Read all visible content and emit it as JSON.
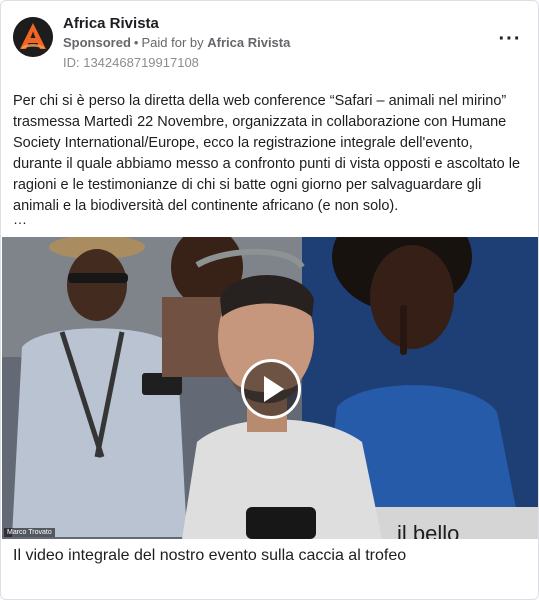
{
  "post": {
    "page_name": "Africa Rivista",
    "sponsored_label": "Sponsored",
    "separator": "•",
    "paid_for_label": "Paid for by",
    "payer_name": "Africa Rivista",
    "ad_id": "ID: 1342468719917108",
    "more_icon": "more-dots-icon",
    "body_text": "Per chi si è perso la diretta della web conference “Safari – animali nel mirino” trasmessa Martedì 22 Novembre, organizzata in collaborazione con Humane Society International/Europe, ecco la registrazione integrale dell'evento, durante il quale abbiamo messo a confronto punti di vista opposti e ascoltato le ragioni e le testimonianze di chi si batte ogni giorno per salvaguardare gli animali e la biodiversità del continente africano (e non solo).",
    "truncation": "…"
  },
  "video": {
    "speaker_label": "Marco Trovato",
    "background_sign_text": "il bello",
    "play_icon": "play-icon"
  },
  "caption": "Il video integrale del nostro evento sulla caccia al trofeo",
  "colors": {
    "logo_orange": "#f26522",
    "text_primary": "#1c1e21",
    "text_secondary": "#65676b",
    "border": "#dddfe2"
  }
}
